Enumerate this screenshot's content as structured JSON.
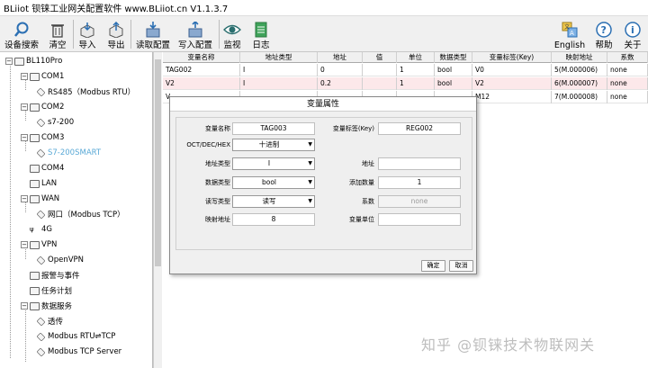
{
  "window": {
    "title": "BLiiot 钡铼工业网关配置软件 www.BLiiot.cn V1.1.3.7"
  },
  "toolbar": {
    "buttons": [
      {
        "label": "设备搜索",
        "icon": "search-icon"
      },
      {
        "label": "清空",
        "icon": "trash-icon"
      },
      {
        "label": "导入",
        "icon": "import-icon"
      },
      {
        "label": "导出",
        "icon": "export-icon"
      },
      {
        "label": "读取配置",
        "icon": "read-config-icon"
      },
      {
        "label": "写入配置",
        "icon": "write-config-icon"
      },
      {
        "label": "监视",
        "icon": "eye-icon"
      },
      {
        "label": "日志",
        "icon": "log-icon"
      }
    ],
    "right_buttons": [
      {
        "label": "English",
        "icon": "language-icon"
      },
      {
        "label": "帮助",
        "icon": "help-icon"
      },
      {
        "label": "关于",
        "icon": "info-icon"
      }
    ]
  },
  "tree": {
    "root": "BL110Pro",
    "items": [
      {
        "label": "COM1"
      },
      {
        "label": "RS485（Modbus RTU）"
      },
      {
        "label": "COM2"
      },
      {
        "label": "s7-200"
      },
      {
        "label": "COM3"
      },
      {
        "label": "S7-200SMART"
      },
      {
        "label": "COM4"
      },
      {
        "label": "LAN"
      },
      {
        "label": "WAN"
      },
      {
        "label": "网口（Modbus TCP）"
      },
      {
        "label": "4G"
      },
      {
        "label": "VPN"
      },
      {
        "label": "OpenVPN"
      },
      {
        "label": "报警与事件"
      },
      {
        "label": "任务计划"
      },
      {
        "label": "数据服务"
      },
      {
        "label": "透传"
      },
      {
        "label": "Modbus RTU⇌TCP"
      },
      {
        "label": "Modbus TCP Server"
      }
    ]
  },
  "table": {
    "columns": [
      "变量名称",
      "地址类型",
      "地址",
      "值",
      "单位",
      "数据类型",
      "变量标签(Key)",
      "映射地址",
      "系数"
    ],
    "rows": [
      [
        "TAG002",
        "I",
        "0",
        "",
        "1",
        "bool",
        "V0",
        "5(M.000006)",
        "none"
      ],
      [
        "V2",
        "I",
        "0.2",
        "",
        "1",
        "bool",
        "V2",
        "6(M.000007)",
        "none"
      ],
      [
        "V",
        "",
        "",
        "",
        "",
        "",
        "M12",
        "7(M.000008)",
        "none"
      ]
    ]
  },
  "dialog": {
    "title": "变量属性",
    "labels": {
      "name": "变量名称",
      "key": "变量标签(Key)",
      "format": "OCT/DEC/HEX",
      "addr_type": "地址类型",
      "addr": "地址",
      "data_type": "数据类型",
      "add_count": "添加数量",
      "rw_type": "读写类型",
      "coef": "系数",
      "map_addr": "映射地址",
      "unit": "变量单位"
    },
    "values": {
      "name": "TAG003",
      "key": "REG002",
      "format": "十进制",
      "addr_type": "I",
      "addr": "",
      "data_type": "bool",
      "add_count": "1",
      "rw_type": "读写",
      "coef": "none",
      "map_addr": "8",
      "unit": ""
    },
    "ok_label": "确定",
    "cancel_label": "取消"
  },
  "watermark": "知乎 @钡铼技术物联网关",
  "colors": {
    "selected_row": "#fce8ea",
    "tree_highlight": "#5aa9d6"
  }
}
